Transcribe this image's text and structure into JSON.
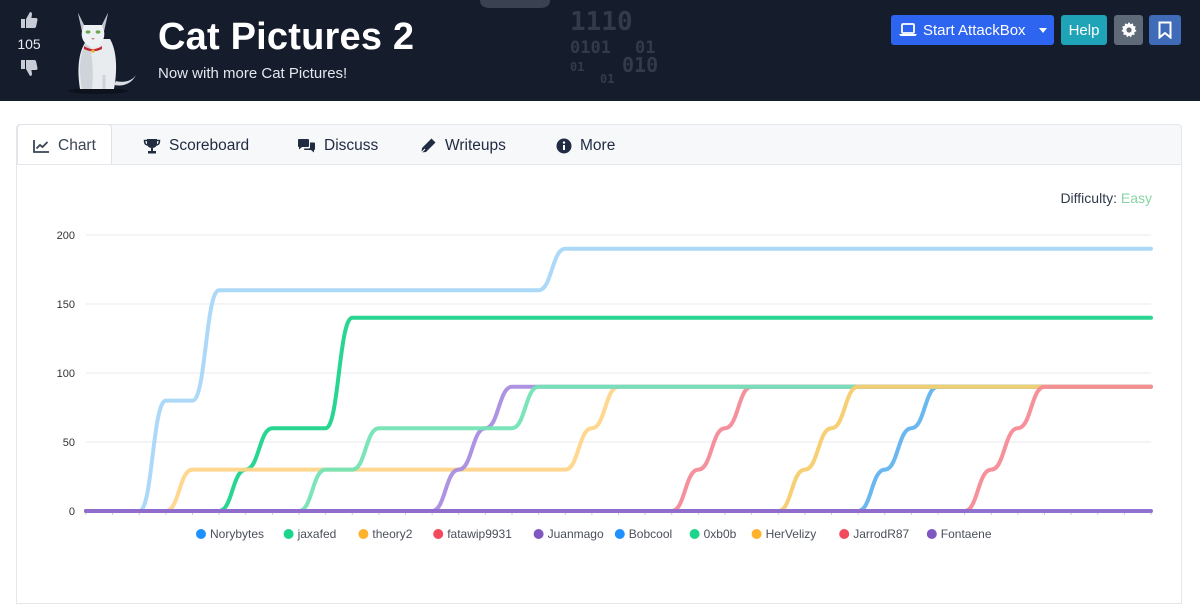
{
  "header": {
    "vote_count": "105",
    "title": "Cat Pictures 2",
    "subtitle": "Now with more Cat Pictures!",
    "binary": [
      "1110",
      "0101",
      "01",
      "01",
      "010",
      "01"
    ],
    "attackbox_label": "Start AttackBox",
    "help_label": "Help"
  },
  "tabs": [
    {
      "label": "Chart",
      "icon": "line-chart-icon",
      "active": true
    },
    {
      "label": "Scoreboard",
      "icon": "trophy-icon"
    },
    {
      "label": "Discuss",
      "icon": "comments-icon"
    },
    {
      "label": "Writeups",
      "icon": "pen-icon"
    },
    {
      "label": "More",
      "icon": "info-circle-icon"
    }
  ],
  "difficulty": {
    "label": "Difficulty:",
    "value": "Easy",
    "color": "#88d4a4"
  },
  "chart_data": {
    "type": "line",
    "ylim": [
      0,
      200
    ],
    "yticks": [
      0,
      50,
      100,
      150,
      200
    ],
    "x_steps": 40,
    "grid": true,
    "legend_position": "bottom",
    "series": [
      {
        "name": "Norybytes",
        "legend_color": "#1e90ff",
        "line_color": "#a9d7f8",
        "points": [
          [
            0,
            0
          ],
          [
            2,
            0
          ],
          [
            3,
            80
          ],
          [
            4,
            80
          ],
          [
            5,
            160
          ],
          [
            17,
            160
          ],
          [
            18,
            190
          ],
          [
            40,
            190
          ]
        ]
      },
      {
        "name": "jaxafed",
        "legend_color": "#1dd48b",
        "line_color": "#1dd48b",
        "points": [
          [
            0,
            0
          ],
          [
            5,
            0
          ],
          [
            6,
            30
          ],
          [
            7,
            60
          ],
          [
            9,
            60
          ],
          [
            10,
            140
          ],
          [
            40,
            140
          ]
        ]
      },
      {
        "name": "theory2",
        "legend_color": "#ffb22b",
        "line_color": "#ffd58a",
        "points": [
          [
            0,
            0
          ],
          [
            3,
            0
          ],
          [
            4,
            30
          ],
          [
            18,
            30
          ],
          [
            19,
            60
          ],
          [
            20,
            90
          ],
          [
            40,
            90
          ]
        ]
      },
      {
        "name": "fatawip9931",
        "legend_color": "#f2495c",
        "line_color": "#f48b97",
        "points": [
          [
            0,
            0
          ],
          [
            22,
            0
          ],
          [
            23,
            30
          ],
          [
            24,
            60
          ],
          [
            25,
            90
          ],
          [
            40,
            90
          ]
        ]
      },
      {
        "name": "Juanmago",
        "legend_color": "#7e57c2",
        "line_color": "#a98de0",
        "points": [
          [
            0,
            0
          ],
          [
            13,
            0
          ],
          [
            14,
            30
          ],
          [
            15,
            60
          ],
          [
            16,
            90
          ],
          [
            40,
            90
          ]
        ]
      },
      {
        "name": "Bobcool",
        "legend_color": "#1e90ff",
        "line_color": "#63b3ef",
        "points": [
          [
            0,
            0
          ],
          [
            29,
            0
          ],
          [
            30,
            30
          ],
          [
            31,
            60
          ],
          [
            32,
            90
          ],
          [
            40,
            90
          ]
        ]
      },
      {
        "name": "0xb0b",
        "legend_color": "#1dd48b",
        "line_color": "#74e3b5",
        "points": [
          [
            0,
            0
          ],
          [
            8,
            0
          ],
          [
            9,
            30
          ],
          [
            10,
            30
          ],
          [
            11,
            60
          ],
          [
            16,
            60
          ],
          [
            17,
            90
          ],
          [
            40,
            90
          ]
        ]
      },
      {
        "name": "HerVelizy",
        "legend_color": "#ffb22b",
        "line_color": "#f7cc6e",
        "points": [
          [
            0,
            0
          ],
          [
            26,
            0
          ],
          [
            27,
            30
          ],
          [
            28,
            60
          ],
          [
            29,
            90
          ],
          [
            40,
            90
          ]
        ]
      },
      {
        "name": "JarrodR87",
        "legend_color": "#f2495c",
        "line_color": "#f58a96",
        "points": [
          [
            0,
            0
          ],
          [
            33,
            0
          ],
          [
            34,
            30
          ],
          [
            35,
            60
          ],
          [
            36,
            90
          ],
          [
            40,
            90
          ]
        ]
      },
      {
        "name": "Fontaene",
        "legend_color": "#7e57c2",
        "line_color": "#8a6bd0",
        "points": [
          [
            0,
            0
          ],
          [
            40,
            0
          ]
        ]
      }
    ]
  }
}
